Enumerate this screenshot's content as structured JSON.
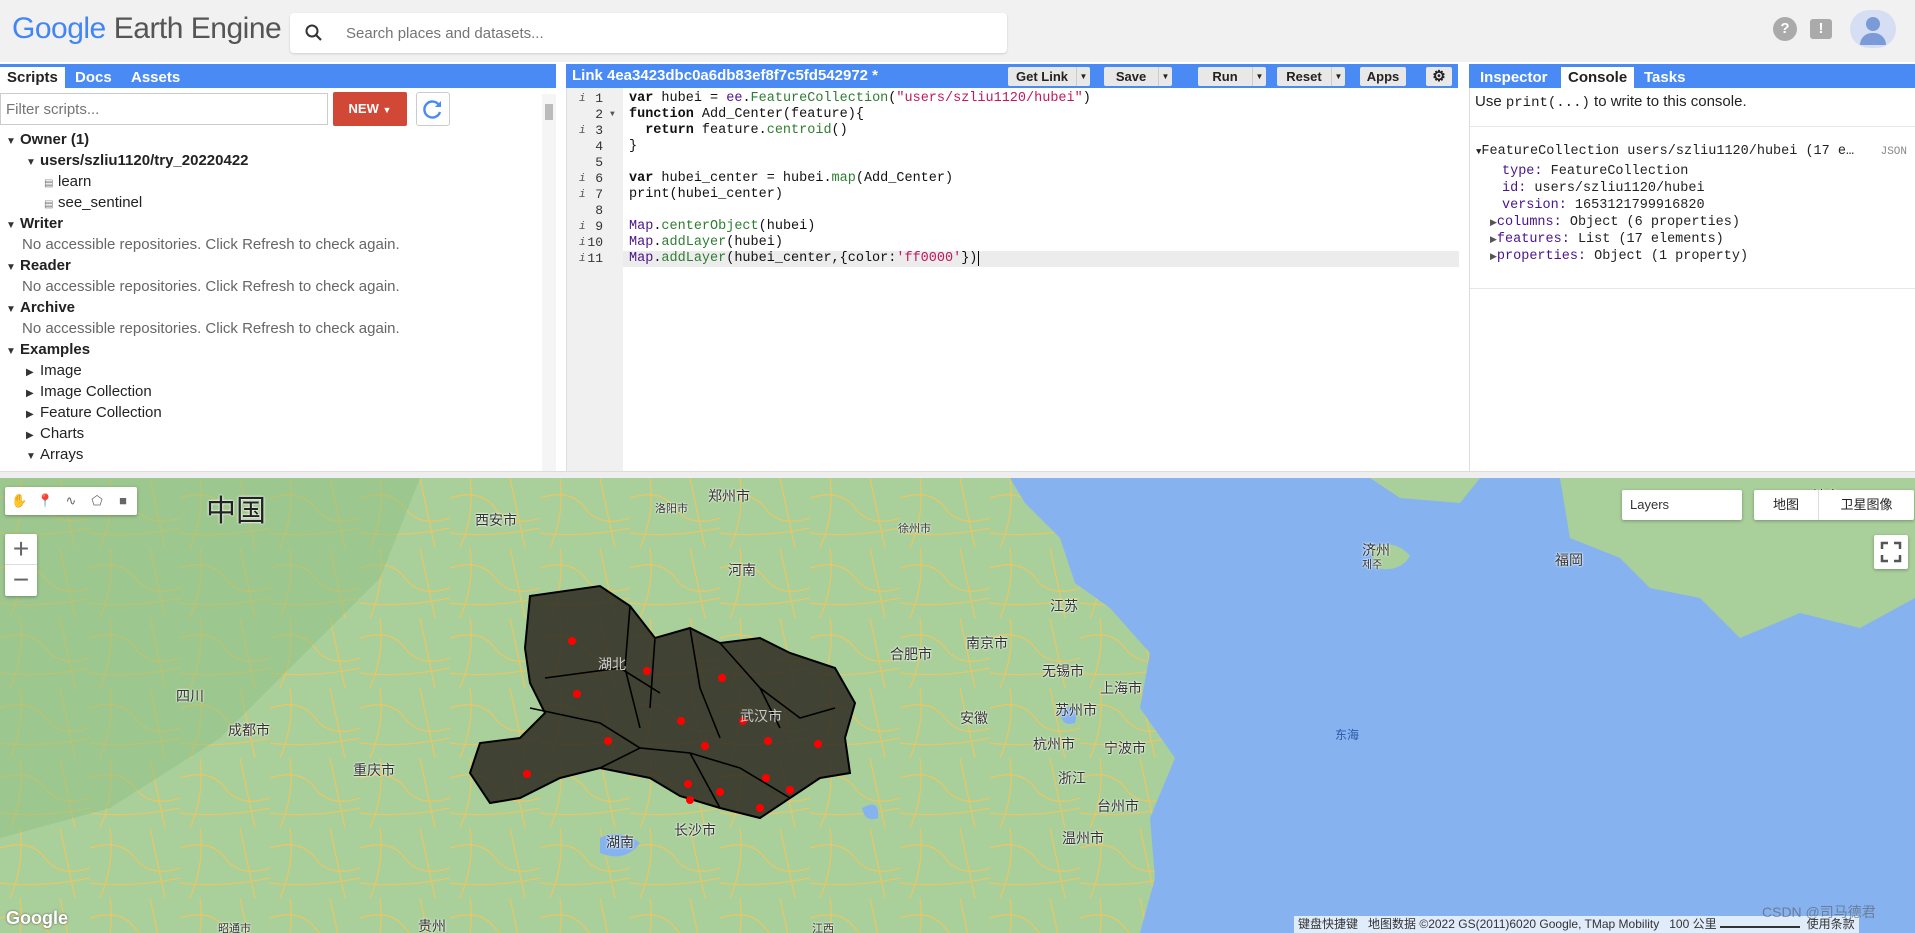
{
  "header": {
    "logo_google": "Google",
    "logo_product": "Earth Engine",
    "search_placeholder": "Search places and datasets...",
    "help_icon": "?",
    "feedback_icon": "!"
  },
  "left_tabs": [
    "Scripts",
    "Docs",
    "Assets"
  ],
  "scripts_panel": {
    "filter_placeholder": "Filter scripts...",
    "new_button": "NEW",
    "tree": [
      {
        "label": "Owner (1)",
        "kind": "header",
        "expanded": true
      },
      {
        "label": "users/szliu1120/try_20220422",
        "kind": "repo",
        "expanded": true
      },
      {
        "label": "learn",
        "kind": "file"
      },
      {
        "label": "see_sentinel",
        "kind": "file"
      },
      {
        "label": "Writer",
        "kind": "header",
        "expanded": true
      },
      {
        "label": "No accessible repositories. Click Refresh to check again.",
        "kind": "message"
      },
      {
        "label": "Reader",
        "kind": "header",
        "expanded": true
      },
      {
        "label": "No accessible repositories. Click Refresh to check again.",
        "kind": "message"
      },
      {
        "label": "Archive",
        "kind": "header",
        "expanded": true
      },
      {
        "label": "No accessible repositories. Click Refresh to check again.",
        "kind": "message"
      },
      {
        "label": "Examples",
        "kind": "header",
        "expanded": true
      },
      {
        "label": "Image",
        "kind": "folder",
        "expanded": false
      },
      {
        "label": "Image Collection",
        "kind": "folder",
        "expanded": false
      },
      {
        "label": "Feature Collection",
        "kind": "folder",
        "expanded": false
      },
      {
        "label": "Charts",
        "kind": "folder",
        "expanded": false
      },
      {
        "label": "Arrays",
        "kind": "folder",
        "expanded": true
      }
    ]
  },
  "editor": {
    "title": "Link 4ea3423dbc0a6db83ef8f7c5fd542972 *",
    "buttons": {
      "get_link": "Get Link",
      "save": "Save",
      "run": "Run",
      "reset": "Reset",
      "apps": "Apps"
    },
    "lines": [
      "var hubei = ee.FeatureCollection(\"users/szliu1120/hubei\")",
      "function Add_Center(feature){",
      "  return feature.centroid()",
      "}",
      "",
      "var hubei_center = hubei.map(Add_Center)",
      "print(hubei_center)",
      "",
      "Map.centerObject(hubei)",
      "Map.addLayer(hubei)",
      "Map.addLayer(hubei_center,{color:'ff0000'})"
    ],
    "info_lines": [
      1,
      3,
      6,
      7,
      9,
      10,
      11
    ],
    "fold_lines": [
      2
    ]
  },
  "right_tabs": [
    "Inspector",
    "Console",
    "Tasks"
  ],
  "console": {
    "message_prefix": "Use",
    "message_code": "print(...)",
    "message_suffix": "to write to this console.",
    "object_header": "FeatureCollection users/szliu1120/hubei (17 e…",
    "json_label": "JSON",
    "rows": [
      {
        "key": "type:",
        "value": "FeatureCollection",
        "expandable": false
      },
      {
        "key": "id:",
        "value": "users/szliu1120/hubei",
        "expandable": false
      },
      {
        "key": "version:",
        "value": "1653121799916820",
        "expandable": false
      },
      {
        "key": "columns:",
        "value": "Object (6 properties)",
        "expandable": true
      },
      {
        "key": "features:",
        "value": "List (17 elements)",
        "expandable": true
      },
      {
        "key": "properties:",
        "value": "Object (1 property)",
        "expandable": true
      }
    ]
  },
  "map": {
    "layers_label": "Layers",
    "map_type_map": "地图",
    "map_type_satellite": "卫星图像",
    "labels": [
      "中国",
      "西安市",
      "洛阳市",
      "郑州市",
      "徐州市",
      "河南",
      "江苏",
      "合肥市",
      "南京市",
      "无锡市",
      "上海市",
      "苏州市",
      "安徽",
      "杭州市",
      "宁波市",
      "浙江",
      "台州市",
      "温州市",
      "长沙市",
      "湖南",
      "四川",
      "成都市",
      "重庆市",
      "济州",
      "제주",
      "福岡",
      "东海",
      "湖北",
      "武汉市",
      "贵州",
      "昭通市",
      "江西",
      "神户"
    ],
    "attribution_keys": "键盘快捷键",
    "attribution_data": "地图数据 ©2022 GS(2011)6020 Google, TMap Mobility",
    "scale": "100 公里",
    "terms": "使用条款",
    "google_logo": "Google",
    "watermark": "CSDN @司马德君",
    "colors": {
      "land": "#a9cf9a",
      "water": "#86b3ef",
      "roads": "#f4c55a",
      "hubei_fill": "#2e2a22",
      "centroid": "#ff0000"
    },
    "centroid_count": 17
  }
}
